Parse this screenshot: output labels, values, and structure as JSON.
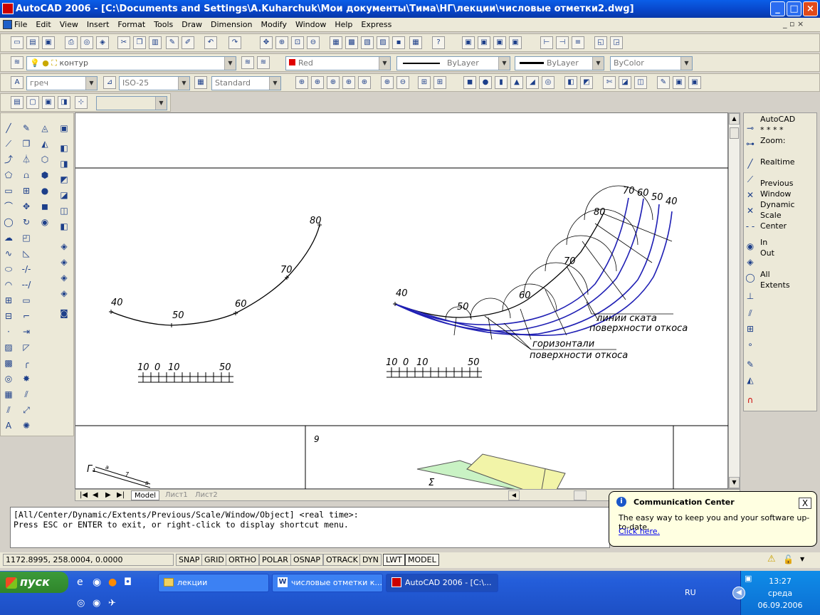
{
  "window": {
    "title": "AutoCAD 2006 - [C:\\Documents and Settings\\A.Kuharchuk\\Мои документы\\Тима\\НГ\\лекции\\числовые отметки2.dwg]",
    "min_label": "_",
    "max_label": "□",
    "close_label": "×"
  },
  "menu": [
    "File",
    "Edit",
    "View",
    "Insert",
    "Format",
    "Tools",
    "Draw",
    "Dimension",
    "Modify",
    "Window",
    "Help",
    "Express"
  ],
  "layers": {
    "current_layer": "контур",
    "color": "Red",
    "linetype": "ByLayer",
    "lineweight": "ByLayer",
    "plotstyle": "ByColor",
    "text_style": "греч",
    "dim_style": "ISO-25",
    "table_style": "Standard"
  },
  "drawing": {
    "left": {
      "labels": [
        "40",
        "50",
        "60",
        "70",
        "80"
      ],
      "scale": {
        "ticks": [
          "10",
          "0",
          "10",
          "50"
        ]
      }
    },
    "right": {
      "labels": [
        "40",
        "50",
        "60",
        "70",
        "80"
      ],
      "top_labels": [
        "70",
        "60",
        "50",
        "40"
      ],
      "scale": {
        "ticks": [
          "10",
          "0",
          "10",
          "50"
        ]
      },
      "annotations": [
        "линии ската",
        "поверхности откоса",
        "горизонтали",
        "поверхности откоса"
      ]
    },
    "bottom": {
      "cell_number": "9",
      "g_label": "Г₁",
      "sigma": "Σ",
      "small_labels": [
        "a",
        "7",
        "в"
      ]
    }
  },
  "tabs": [
    "Model",
    "Лист1",
    "Лист2"
  ],
  "zoom_panel": {
    "header": [
      "AutoCAD",
      "* * * *",
      "Zoom:"
    ],
    "items": [
      "Realtime",
      "",
      "Previous",
      "Window",
      "Dynamic",
      "Scale",
      "Center",
      "",
      "In",
      "Out",
      "",
      "All",
      "Extents"
    ]
  },
  "command_line": {
    "line1": "[All/Center/Dynamic/Extents/Previous/Scale/Window/Object] <real time>:",
    "line2": "Press ESC or ENTER to exit, or right-click to display shortcut menu."
  },
  "status": {
    "coords": "1172.8995, 258.0004, 0.0000",
    "buttons": [
      "SNAP",
      "GRID",
      "ORTHO",
      "POLAR",
      "OSNAP",
      "OTRACK",
      "DYN",
      "LWT",
      "MODEL"
    ]
  },
  "balloon": {
    "title": "Communication Center",
    "body": "The easy way to keep you and your software up-to-date.",
    "link": "Click here.",
    "close_label": "X"
  },
  "taskbar": {
    "start": "пуск",
    "tasks": [
      "лекции",
      "числовые отметки к...",
      "AutoCAD 2006 - [C:\\..."
    ],
    "lang": "RU",
    "time": "13:27",
    "day": "среда",
    "date": "06.09.2006"
  },
  "colors": {
    "blue_curves": "#1f1fb4",
    "title_bg": "#0a5ee8",
    "taskbar_bg": "#245edb"
  }
}
